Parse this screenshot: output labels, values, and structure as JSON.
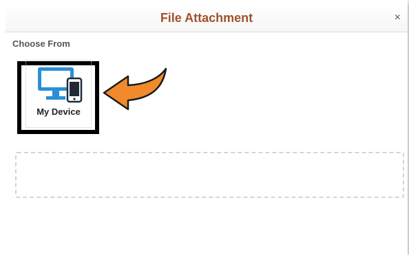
{
  "dialog": {
    "title": "File Attachment",
    "close_glyph": "×",
    "title_color": "#a0522d"
  },
  "choose": {
    "label": "Choose From",
    "options": [
      {
        "label": "My Device",
        "icon": "desktop-and-phone-icon",
        "selected": true
      }
    ]
  },
  "colors": {
    "icon_blue": "#2b8fd6",
    "arrow_orange": "#f08a2c",
    "highlight_border": "#000000"
  }
}
